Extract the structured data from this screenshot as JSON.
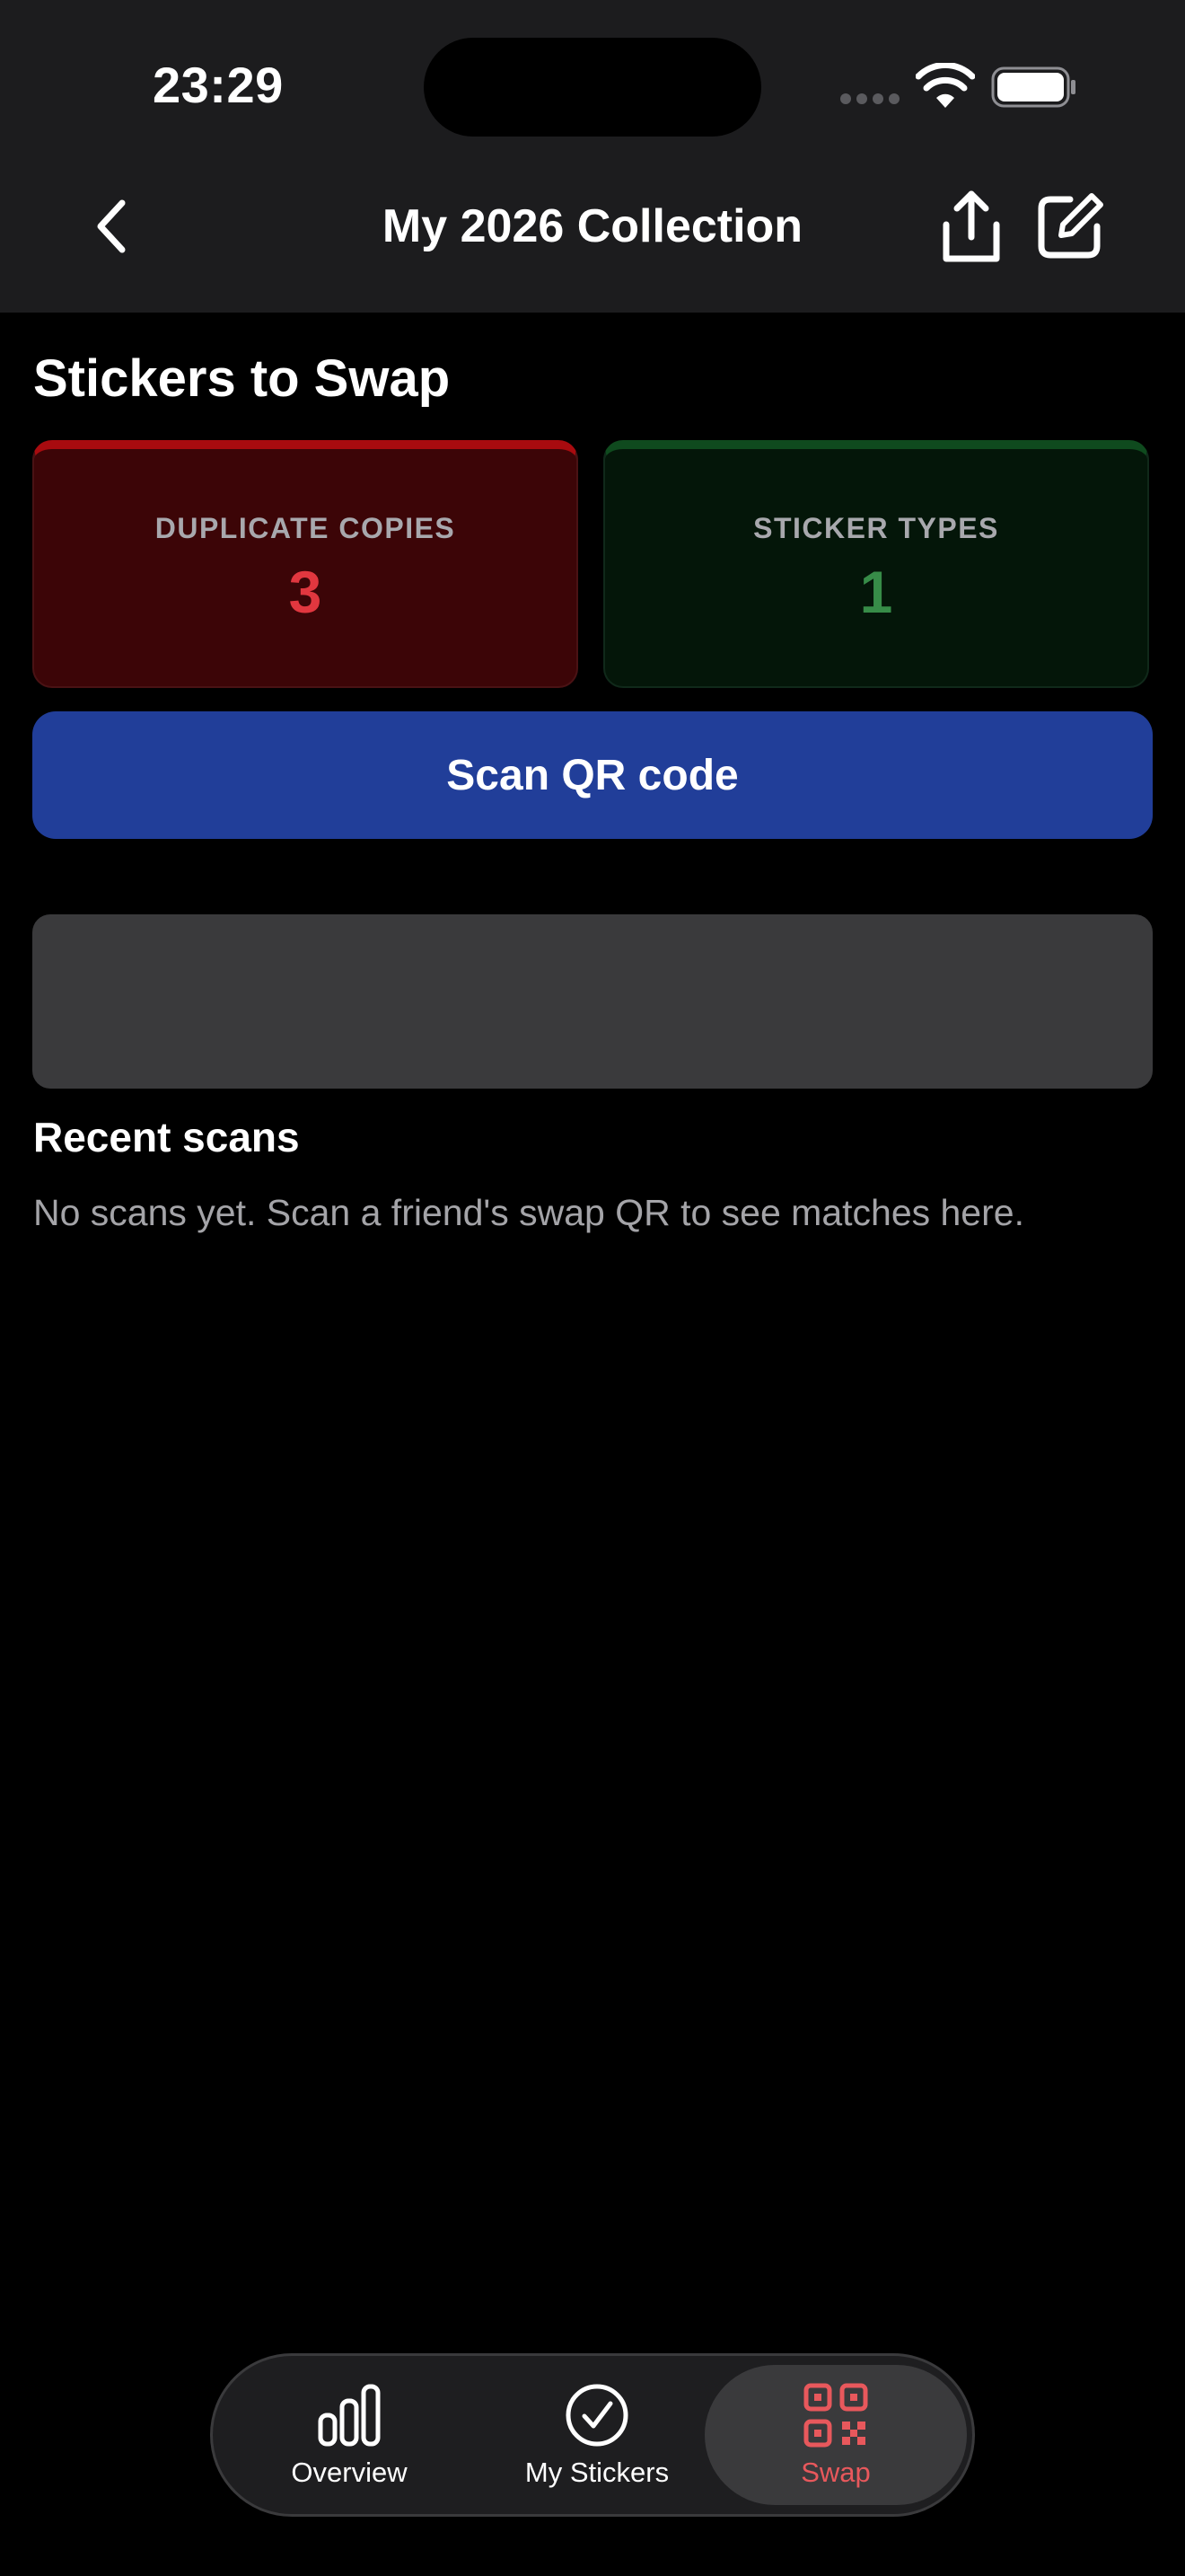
{
  "status_bar": {
    "time": "23:29"
  },
  "nav": {
    "title": "My 2026 Collection",
    "back_icon": "chevron-left-icon",
    "share_icon": "share-icon",
    "edit_icon": "edit-icon"
  },
  "page": {
    "section_title": "Stickers to Swap",
    "stats": {
      "duplicate_copies": {
        "label": "DUPLICATE COPIES",
        "value": "3",
        "accent": "#e1373f"
      },
      "sticker_types": {
        "label": "STICKER TYPES",
        "value": "1",
        "accent": "#378c48"
      }
    },
    "scan_button": {
      "label": "Scan QR code",
      "color": "#213e99"
    },
    "recent": {
      "title": "Recent scans",
      "empty_text": "No scans yet. Scan a friend's swap QR to see matches here."
    }
  },
  "tab_bar": {
    "items": [
      {
        "label": "Overview",
        "icon": "bar-chart-icon",
        "selected": false
      },
      {
        "label": "My Stickers",
        "icon": "checkmark-circle-icon",
        "selected": false
      },
      {
        "label": "Swap",
        "icon": "qr-code-icon",
        "selected": true
      }
    ],
    "accent": "#e8585c"
  }
}
